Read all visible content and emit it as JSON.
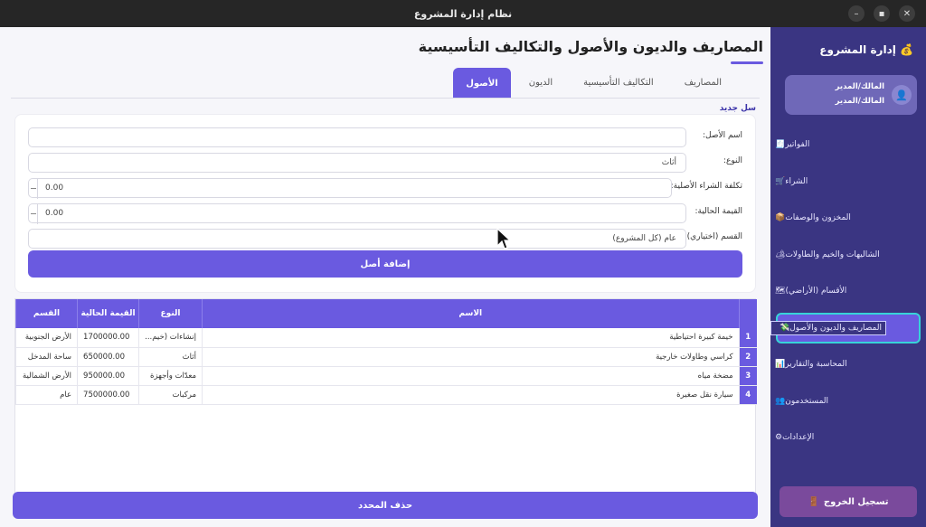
{
  "window": {
    "title": "نظام إدارة المشروع",
    "buttons": [
      "–",
      "▪",
      "✕"
    ]
  },
  "page": {
    "title": "المصاريف والديون والأصول والتكاليف التأسيسية",
    "tabs": [
      {
        "label": "المصاريف",
        "active": false
      },
      {
        "label": "التكاليف التأسيسية",
        "active": false
      },
      {
        "label": "الديون",
        "active": false
      },
      {
        "label": "الأصول",
        "active": true
      }
    ],
    "group_title": "سل جديد"
  },
  "form": {
    "asset_name_label": "اسم الأصل:",
    "asset_name_value": "",
    "type_label": "النوع:",
    "type_value": "أثاث",
    "purchase_cost_label": "تكلفة الشراء الأصلية:",
    "purchase_cost_value": "0.00",
    "current_value_label": "القيمة الحالية:",
    "current_value_value": "0.00",
    "department_label": "القسم (اختياري):",
    "department_value": "عام (كل المشروع)",
    "add_button": "إضافة أصل"
  },
  "table": {
    "headers": {
      "name": "الاسم",
      "type": "النوع",
      "value": "القيمة الحالية",
      "dept": "القسم"
    },
    "rows": [
      {
        "idx": "1",
        "name": "خيمة كبيرة احتياطية",
        "type": "إنشاءات (خيم...",
        "value": "1700000.00",
        "dept": "الأرض الجنوبية"
      },
      {
        "idx": "2",
        "name": "كراسي وطاولات خارجية",
        "type": "أثاث",
        "value": "650000.00",
        "dept": "ساحة المدخل"
      },
      {
        "idx": "3",
        "name": "مضخة مياه",
        "type": "معدّات وأجهزة",
        "value": "950000.00",
        "dept": "الأرض الشمالية"
      },
      {
        "idx": "4",
        "name": "سيارة نقل صغيرة",
        "type": "مركبات",
        "value": "7500000.00",
        "dept": "عام"
      }
    ]
  },
  "delete_button": "حذف المحدد",
  "sidebar": {
    "brand": "إدارة المشروع",
    "brand_icon": "💰",
    "user_line1": "المالك/المدير",
    "user_line2": "المالك/المدير",
    "user_icon": "👤",
    "items": [
      {
        "label": "الفواتير",
        "icon": "🧾"
      },
      {
        "label": "الشراء",
        "icon": "🛒"
      },
      {
        "label": "المخزون والوصفات",
        "icon": "📦"
      },
      {
        "label": "الشاليهات والخيم والطاولات",
        "icon": "🏕"
      },
      {
        "label": "الأقسام (الأراضي)",
        "icon": "🗺"
      },
      {
        "label": "المصاريف والديون والأصول",
        "icon": "💸"
      },
      {
        "label": "المحاسبة والتقارير",
        "icon": "📊"
      },
      {
        "label": "المستخدمون",
        "icon": "👥"
      },
      {
        "label": "الإعدادات",
        "icon": "⚙"
      }
    ],
    "active_index": 5,
    "logout": "تسجيل الخروج",
    "logout_icon": "🚪"
  }
}
